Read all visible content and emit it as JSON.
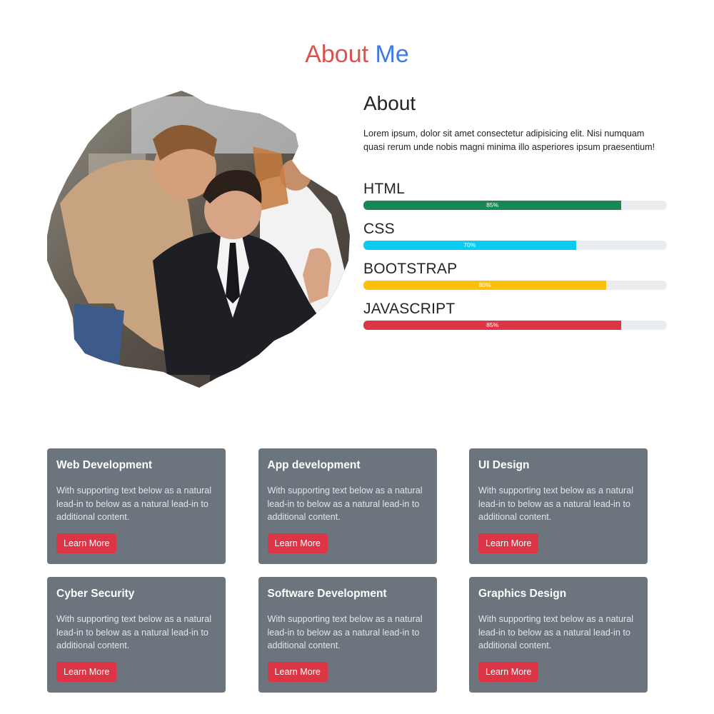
{
  "header": {
    "title_word_1": "About",
    "title_word_2": "Me",
    "colors": {
      "word_1": "#d9534f",
      "word_2": "#3d7be0"
    }
  },
  "about": {
    "heading": "About",
    "text": "Lorem ipsum, dolor sit amet consectetur adipisicing elit. Nisi numquam quasi rerum unde nobis magni minima illo asperiores ipsum praesentium!",
    "photo_icon": "team-photo"
  },
  "skills": [
    {
      "name": "HTML",
      "percent": 85,
      "label": "85%",
      "color": "#198754"
    },
    {
      "name": "CSS",
      "percent": 70,
      "label": "70%",
      "color": "#0dcaf0"
    },
    {
      "name": "BOOTSTRAP",
      "percent": 80,
      "label": "80%",
      "color": "#ffc107"
    },
    {
      "name": "JAVASCRIPT",
      "percent": 85,
      "label": "85%",
      "color": "#dc3545"
    }
  ],
  "cards": [
    {
      "title": "Web Development",
      "text": "With supporting text below as a natural lead-in to below as a natural lead-in to additional content.",
      "button": "Learn More"
    },
    {
      "title": "App development",
      "text": "With supporting text below as a natural lead-in to below as a natural lead-in to additional content.",
      "button": "Learn More"
    },
    {
      "title": "UI Design",
      "text": "With supporting text below as a natural lead-in to below as a natural lead-in to additional content.",
      "button": "Learn More"
    },
    {
      "title": "Cyber Security",
      "text": "With supporting text below as a natural lead-in to below as a natural lead-in to additional content.",
      "button": "Learn More"
    },
    {
      "title": "Software Development",
      "text": "With supporting text below as a natural lead-in to below as a natural lead-in to additional content.",
      "button": "Learn More"
    },
    {
      "title": "Graphics Design",
      "text": "With supporting text below as a natural lead-in to below as a natural lead-in to additional content.",
      "button": "Learn More"
    }
  ],
  "colors": {
    "card_bg": "#6c757d",
    "button_bg": "#dc3545",
    "progress_track": "#e9ecef"
  }
}
